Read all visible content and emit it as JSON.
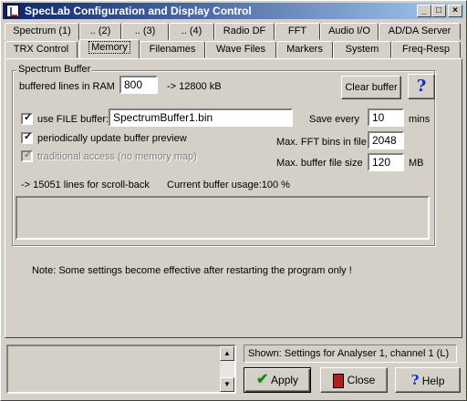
{
  "window": {
    "title": "SpecLab  Configuration and Display Control",
    "min_icon": "minimize-icon",
    "max_icon": "maximize-icon",
    "close_icon": "close-icon"
  },
  "tabs_row1": [
    "Spectrum (1)",
    ".. (2)",
    ".. (3)",
    ".. (4)",
    "Radio DF",
    "FFT",
    "Audio I/O",
    "AD/DA Server"
  ],
  "tabs_row2": [
    "TRX Control",
    "Memory",
    "Filenames",
    "Wave Files",
    "Markers",
    "System",
    "Freq-Resp"
  ],
  "active_tab": "Memory",
  "spectrum_buffer": {
    "legend": "Spectrum Buffer",
    "lines_label": "buffered lines in RAM",
    "lines_value": "800",
    "lines_kb": "-> 12800 kB",
    "clear_button": "Clear buffer",
    "help_q": "?",
    "use_file_label": "use FILE buffer:",
    "use_file_checked": true,
    "file_name": "SpectrumBuffer1.bin",
    "save_every_label": "Save every",
    "save_every_value": "10",
    "save_every_unit": "mins",
    "periodic_label": "periodically update buffer preview",
    "periodic_checked": true,
    "max_fft_label": "Max. FFT bins in file",
    "max_fft_value": "2048",
    "traditional_label": "traditional access (no memory map)",
    "traditional_checked": true,
    "max_size_label": "Max. buffer file size",
    "max_size_value": "120",
    "max_size_unit": "MB",
    "scrollback": "-> 15051 lines for scroll-back",
    "usage": "Current buffer usage:100 %"
  },
  "note": "Note: Some settings become effective after restarting the program only !",
  "shown": "Shown: Settings for Analyser 1, channel 1 (L)",
  "buttons": {
    "apply": "Apply",
    "close": "Close",
    "help": "Help"
  }
}
